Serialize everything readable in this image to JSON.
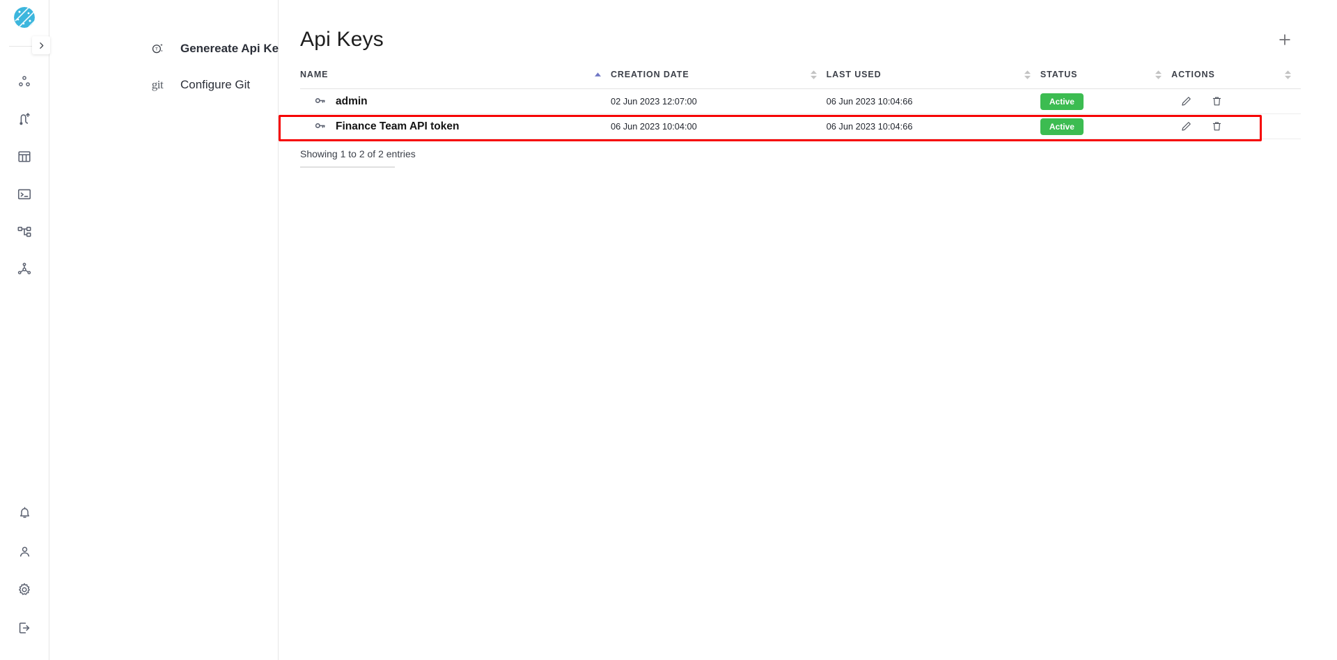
{
  "brand": {
    "logo_name": "app-logo",
    "logo_color": "#3cb6dd"
  },
  "rail": {
    "top_items": [
      {
        "name": "nodes-cluster-icon",
        "label": "Clusters"
      },
      {
        "name": "route-path-icon",
        "label": "Pipelines"
      },
      {
        "name": "table-columns-icon",
        "label": "Tables"
      },
      {
        "name": "terminal-icon",
        "label": "Console"
      },
      {
        "name": "hierarchy-icon",
        "label": "Topology"
      },
      {
        "name": "network-graph-icon",
        "label": "Network"
      }
    ],
    "bottom_items": [
      {
        "name": "bell-icon",
        "label": "Notifications"
      },
      {
        "name": "user-icon",
        "label": "Profile"
      },
      {
        "name": "gear-icon",
        "label": "Settings"
      },
      {
        "name": "logout-icon",
        "label": "Log out"
      }
    ],
    "collapse_icon": "chevron-right-icon"
  },
  "subnav": {
    "items": [
      {
        "label": "Genereate Api Key",
        "icon": "generate-token-icon",
        "active": true
      },
      {
        "label": "Configure Git",
        "icon": "git-icon",
        "active": false
      }
    ],
    "git_mark": "git"
  },
  "header": {
    "title": "Api Keys",
    "add_button_label": "+",
    "add_button_name": "add-api-key-button"
  },
  "table": {
    "columns": [
      {
        "label": "NAME",
        "sort": "asc"
      },
      {
        "label": "CREATION DATE",
        "sort": "none"
      },
      {
        "label": "LAST USED",
        "sort": "none"
      },
      {
        "label": "STATUS",
        "sort": "none"
      },
      {
        "label": "ACTIONS",
        "sort": "none"
      }
    ],
    "rows": [
      {
        "name": "admin",
        "creation_date": "02 Jun 2023 12:07:00",
        "last_used": "06 Jun 2023 10:04:66",
        "status": "Active",
        "highlighted": false
      },
      {
        "name": "Finance Team API token",
        "creation_date": "06 Jun 2023 10:04:00",
        "last_used": "06 Jun 2023 10:04:66",
        "status": "Active",
        "highlighted": true
      }
    ],
    "edit_icon": "pencil-icon",
    "delete_icon": "trash-icon",
    "status_color": "#3cbc51",
    "highlight_color": "#f60000"
  },
  "footer": {
    "entries_text": "Showing 1 to 2 of 2 entries"
  }
}
